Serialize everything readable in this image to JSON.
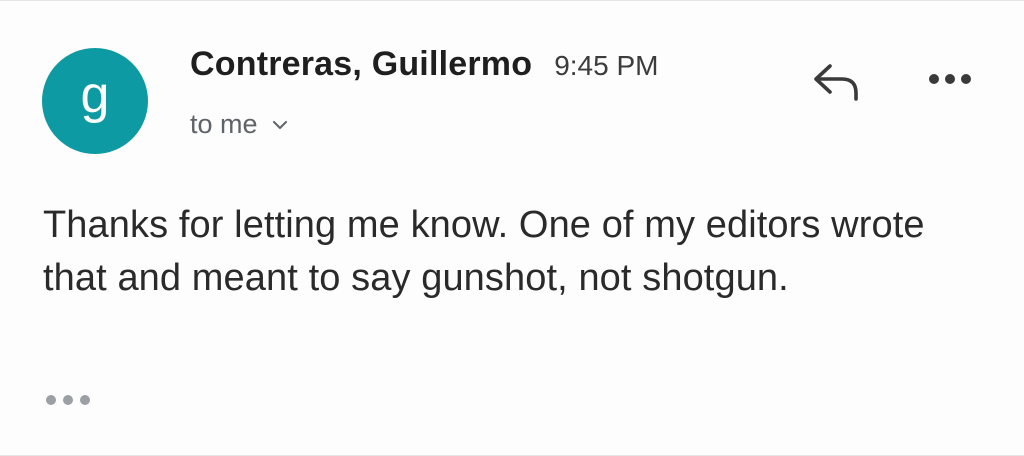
{
  "sender": {
    "avatar_letter": "g",
    "avatar_color": "#0d9aa3",
    "name": "Contreras, Guillermo",
    "time": "9:45 PM",
    "recipient": "to me"
  },
  "actions": {
    "reply_icon": "reply-icon",
    "more_icon": "more-horizontal-icon",
    "expand_icon": "chevron-down-icon"
  },
  "message": {
    "body": "Thanks for letting me know. One of my editors wrote that and meant to say gunshot, not shotgun.",
    "trimmed_content_icon": "ellipsis-icon"
  }
}
